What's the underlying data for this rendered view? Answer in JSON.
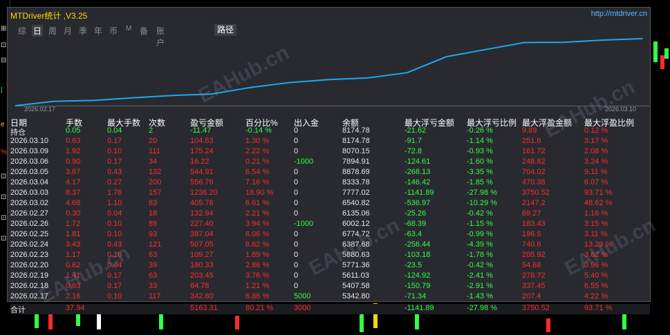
{
  "window": {
    "title": "MTDriver统计 ,V3.25",
    "url": "http://mtdriver.cn"
  },
  "tabs": [
    {
      "label": "综",
      "active": false
    },
    {
      "label": "日",
      "active": true
    },
    {
      "label": "周",
      "active": false
    },
    {
      "label": "月",
      "active": false
    },
    {
      "label": "季",
      "active": false
    },
    {
      "label": "年",
      "active": false
    },
    {
      "label": "币",
      "active": false
    },
    {
      "label": "M",
      "active": false
    },
    {
      "label": "备",
      "active": false
    },
    {
      "label": "账户",
      "active": false
    }
  ],
  "route_button": "路径",
  "chart_data": {
    "type": "line",
    "x": [
      "2026.02.17",
      "2026.02.18",
      "2026.02.19",
      "2026.02.20",
      "2026.02.23",
      "2026.02.24",
      "2026.02.25",
      "2026.02.26",
      "2026.02.27",
      "2026.03.02",
      "2026.03.03",
      "2026.03.04",
      "2026.03.05",
      "2026.03.06",
      "2026.03.09",
      "2026.03.10"
    ],
    "y": [
      342.8,
      407.48,
      610.93,
      791.26,
      900.53,
      1407.58,
      1794.62,
      2022.02,
      2154.96,
      2560.72,
      3796.92,
      4353.68,
      4898.59,
      4914.81,
      5090.05,
      5194.68
    ],
    "x_tick_labels": [
      "2026.02.17",
      "2026.03.10"
    ],
    "color": "#1ea8f0",
    "grid": false
  },
  "table": {
    "headers": [
      "日期",
      "手数",
      "最大手数",
      "次数",
      "盈亏金额",
      "百分比%",
      "出入金",
      "余额",
      "最大浮亏金额",
      "最大浮亏比例",
      "最大浮盈金额",
      "最大浮盈比例"
    ],
    "holding": [
      "持仓",
      "0.05",
      "0.04",
      "2",
      "-11.47",
      "-0.14 %",
      "0",
      "8174.78",
      "-21.62",
      "-0.26 %",
      "9.89",
      "0.12 %"
    ],
    "rows": [
      [
        "2026.03.10",
        "0.63",
        "0.17",
        "20",
        "104.63",
        "1.30 %",
        "0",
        "8174.78",
        "-91.7",
        "-1.14 %",
        "251.6",
        "3.17 %"
      ],
      [
        "2026.03.09",
        "1.92",
        "0.10",
        "111",
        "175.24",
        "2.22 %",
        "0",
        "8070.15",
        "-72.8",
        "-0.93 %",
        "161.72",
        "2.08 %"
      ],
      [
        "2026.03.06",
        "0.90",
        "0.17",
        "34",
        "16.22",
        "0.21 %",
        "-1000",
        "7894.91",
        "-124.61",
        "-1.60 %",
        "248.82",
        "3.24 %"
      ],
      [
        "2026.03.05",
        "3.67",
        "0.43",
        "132",
        "544.91",
        "6.54 %",
        "0",
        "8878.69",
        "-268.13",
        "-3.35 %",
        "704.02",
        "9.11 %"
      ],
      [
        "2026.03.04",
        "4.17",
        "0.27",
        "200",
        "556.76",
        "7.16 %",
        "0",
        "8333.78",
        "-146.42",
        "-1.85 %",
        "470.38",
        "6.07 %"
      ],
      [
        "2026.03.03",
        "8.37",
        "1.76",
        "157",
        "1236.20",
        "18.90 %",
        "0",
        "7777.02",
        "-1141.89",
        "-27.98 %",
        "3750.52",
        "93.71 %"
      ],
      [
        "2026.03.02",
        "4.68",
        "1.10",
        "83",
        "405.76",
        "6.61 %",
        "0",
        "6540.82",
        "-536.97",
        "-10.29 %",
        "2147.2",
        "48.62 %"
      ],
      [
        "2026.02.27",
        "0.30",
        "0.04",
        "18",
        "132.94",
        "2.21 %",
        "0",
        "6135.06",
        "-25.26",
        "-0.42 %",
        "69.27",
        "1.16 %"
      ],
      [
        "2026.02.26",
        "1.72",
        "0.10",
        "89",
        "227.40",
        "3.94 %",
        "-1000",
        "6002.12",
        "-68.39",
        "-1.15 %",
        "183.43",
        "3.15 %"
      ],
      [
        "2026.02.25",
        "1.81",
        "0.10",
        "93",
        "387.04",
        "6.06 %",
        "0",
        "6774.72",
        "-63.4",
        "-0.99 %",
        "196.5",
        "3.11 %"
      ],
      [
        "2026.02.24",
        "3.43",
        "0.43",
        "121",
        "507.05",
        "8.62 %",
        "0",
        "6387.68",
        "-256.44",
        "-4.39 %",
        "740.6",
        "13.29 %"
      ],
      [
        "2026.02.23",
        "1.17",
        "0.10",
        "63",
        "109.27",
        "1.89 %",
        "0",
        "5880.63",
        "-103.18",
        "-1.78 %",
        "205.92",
        "3.62 %"
      ],
      [
        "2026.02.20",
        "0.62",
        "0.04",
        "39",
        "180.33",
        "2.86 %",
        "0",
        "5771.36",
        "-23.5",
        "-0.42 %",
        "54.68",
        "0.96 %"
      ],
      [
        "2026.02.19",
        "1.41",
        "0.17",
        "63",
        "203.45",
        "3.76 %",
        "0",
        "5611.03",
        "-124.92",
        "-2.41 %",
        "278.72",
        "5.40 %"
      ],
      [
        "2026.02.18",
        "0.93",
        "0.17",
        "33",
        "64.78",
        "1.21 %",
        "0",
        "5407.58",
        "-150.79",
        "-2.91 %",
        "337.45",
        "6.55 %"
      ],
      [
        "2026.02.17",
        "2.16",
        "0.10",
        "117",
        "342.80",
        "6.86 %",
        "5000",
        "5342.80",
        "-71.34",
        "-1.43 %",
        "207.4",
        "4.22 %"
      ]
    ],
    "total": [
      "合计",
      "37.94",
      "",
      "",
      "5163.31",
      "80.21 %",
      "3000",
      "",
      "-1141.89",
      "-27.98 %",
      "3750.52",
      "93.71 %"
    ]
  },
  "watermark": "EAHub.cn",
  "colors": {
    "positive": "#ff2b2b",
    "negative": "#33ff44",
    "neutral": "#e8e8e8",
    "title": "#ffd700",
    "url": "#55b8ff"
  }
}
